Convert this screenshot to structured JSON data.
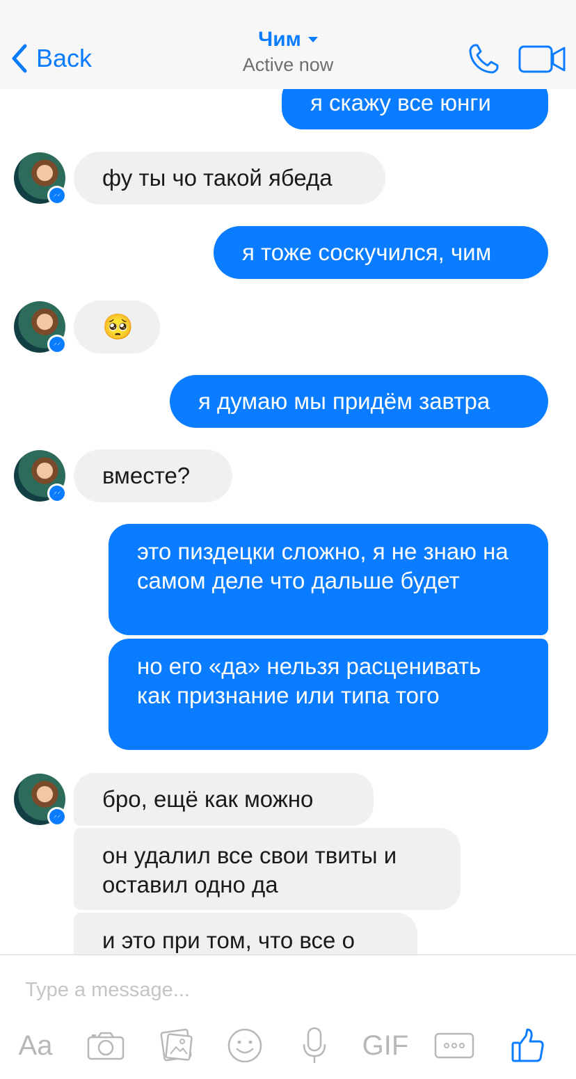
{
  "header": {
    "back_label": "Back",
    "title": "Чим",
    "subtitle": "Active now",
    "icons": [
      "chevron-left-icon",
      "caret-down-icon",
      "phone-icon",
      "video-camera-icon"
    ],
    "accent_color": "#0a7cff"
  },
  "messages": [
    {
      "from": "me",
      "text": "я скажу все юнги"
    },
    {
      "from": "them",
      "text": "фу ты чо такой ябеда"
    },
    {
      "from": "me",
      "text": "я тоже соскучился, чим"
    },
    {
      "from": "them",
      "text": "🥺"
    },
    {
      "from": "me",
      "text": "я думаю мы придём завтра"
    },
    {
      "from": "them",
      "text": "вместе?"
    },
    {
      "from": "me",
      "text": "это пиздецки сложно, я не знаю на самом деле что дальше будет"
    },
    {
      "from": "me",
      "text": "но его «да» нельзя расценивать как признание или типа того"
    },
    {
      "from": "them",
      "text": "бро, ещё как можно"
    },
    {
      "from": "them",
      "text": "он удалил все свои твиты и оставил одно да"
    },
    {
      "from": "them",
      "text": "и это при том, что все о"
    }
  ],
  "composer": {
    "placeholder": "Type a message...",
    "aa_label": "Aa",
    "gif_label": "GIF",
    "icons": [
      "camera-icon",
      "gallery-icon",
      "emoji-icon",
      "microphone-icon",
      "more-icon",
      "thumbs-up-icon"
    ]
  },
  "colors": {
    "outgoing_bubble": "#0a7cff",
    "incoming_bubble": "#f1f0f0",
    "toolbar_icons": "#b7b7bc"
  }
}
